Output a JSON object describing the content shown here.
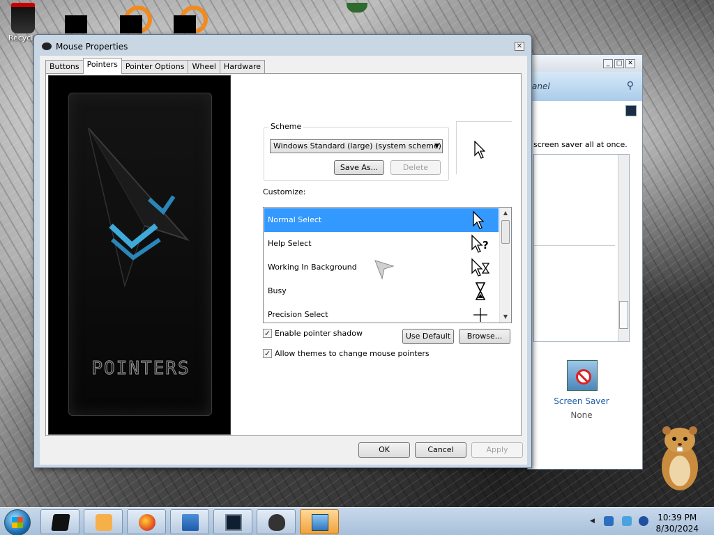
{
  "desktop": {
    "recycle_bin_label": "Recycle"
  },
  "control_panel": {
    "address_text": "anel",
    "description_text": "screen saver all at once.",
    "screen_saver_label": "Screen Saver",
    "screen_saver_value": "None",
    "icons": {
      "search": "search-icon",
      "minimize": "minimize-icon",
      "maximize": "maximize-icon",
      "close": "close-icon"
    }
  },
  "dialog": {
    "title": "Mouse Properties",
    "close_glyph": "✕",
    "tabs": [
      {
        "label": "Buttons",
        "active": false
      },
      {
        "label": "Pointers",
        "active": true
      },
      {
        "label": "Pointer Options",
        "active": false
      },
      {
        "label": "Wheel",
        "active": false
      },
      {
        "label": "Hardware",
        "active": false
      }
    ],
    "preview_text": "POINTERS",
    "scheme": {
      "legend": "Scheme",
      "selected": "Windows Standard (large) (system scheme)",
      "save_as_label": "Save As...",
      "delete_label": "Delete"
    },
    "customize_label": "Customize:",
    "cursor_rows": [
      {
        "label": "Normal Select",
        "selected": true,
        "icon": "arrow-cursor-icon"
      },
      {
        "label": "Help Select",
        "selected": false,
        "icon": "help-cursor-icon"
      },
      {
        "label": "Working In Background",
        "selected": false,
        "icon": "working-cursor-icon"
      },
      {
        "label": "Busy",
        "selected": false,
        "icon": "hourglass-cursor-icon"
      },
      {
        "label": "Precision Select",
        "selected": false,
        "icon": "crosshair-cursor-icon"
      }
    ],
    "enable_shadow_label": "Enable pointer shadow",
    "enable_shadow_checked": true,
    "use_default_label": "Use Default",
    "browse_label": "Browse...",
    "allow_themes_label": "Allow themes to change mouse pointers",
    "allow_themes_checked": true,
    "ok_label": "OK",
    "cancel_label": "Cancel",
    "apply_label": "Apply"
  },
  "taskbar": {
    "items": [
      {
        "icon": "start-orb-icon"
      },
      {
        "icon": "black-box-app-icon"
      },
      {
        "icon": "media-player-icon"
      },
      {
        "icon": "firefox-icon"
      },
      {
        "icon": "update-check-icon"
      },
      {
        "icon": "monitor-app-icon"
      },
      {
        "icon": "mouse-app-icon"
      },
      {
        "icon": "control-panel-icon"
      }
    ],
    "time": "10:39 PM",
    "date": "8/30/2024"
  },
  "colors": {
    "selection_blue": "#3399ff",
    "taskbar_active": "#f0a23a",
    "link_blue": "#1e5ea8"
  }
}
